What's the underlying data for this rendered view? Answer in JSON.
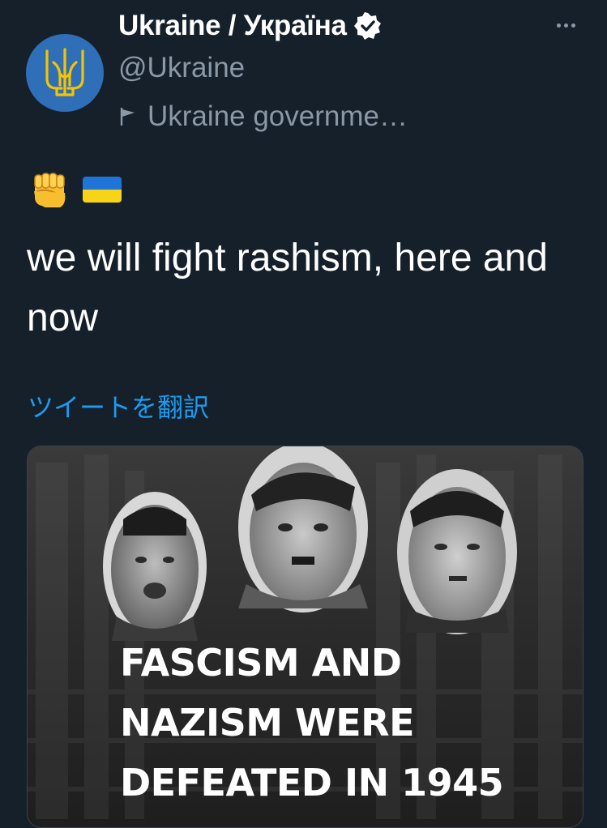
{
  "account": {
    "display_name": "Ukraine / Україна",
    "handle": "@Ukraine",
    "label": "Ukraine governme…",
    "verified": true,
    "avatar_color": "#2f6fb7",
    "avatar_icon": "trident-coat-of-arms-icon"
  },
  "tweet": {
    "emojis": [
      "fist-emoji",
      "ukraine-flag-emoji"
    ],
    "text": "we will fight rashism, here and now",
    "translate_label": "ツイートを翻訳"
  },
  "media": {
    "caption_lines": [
      "FASCISM AND",
      "NAZISM WERE",
      "DEFEATED IN 1945"
    ]
  },
  "colors": {
    "background": "#15202b",
    "secondary_text": "#8b98a5",
    "link": "#1d9bf0",
    "flag_blue": "#1f74d8",
    "flag_yellow": "#f7d417"
  }
}
